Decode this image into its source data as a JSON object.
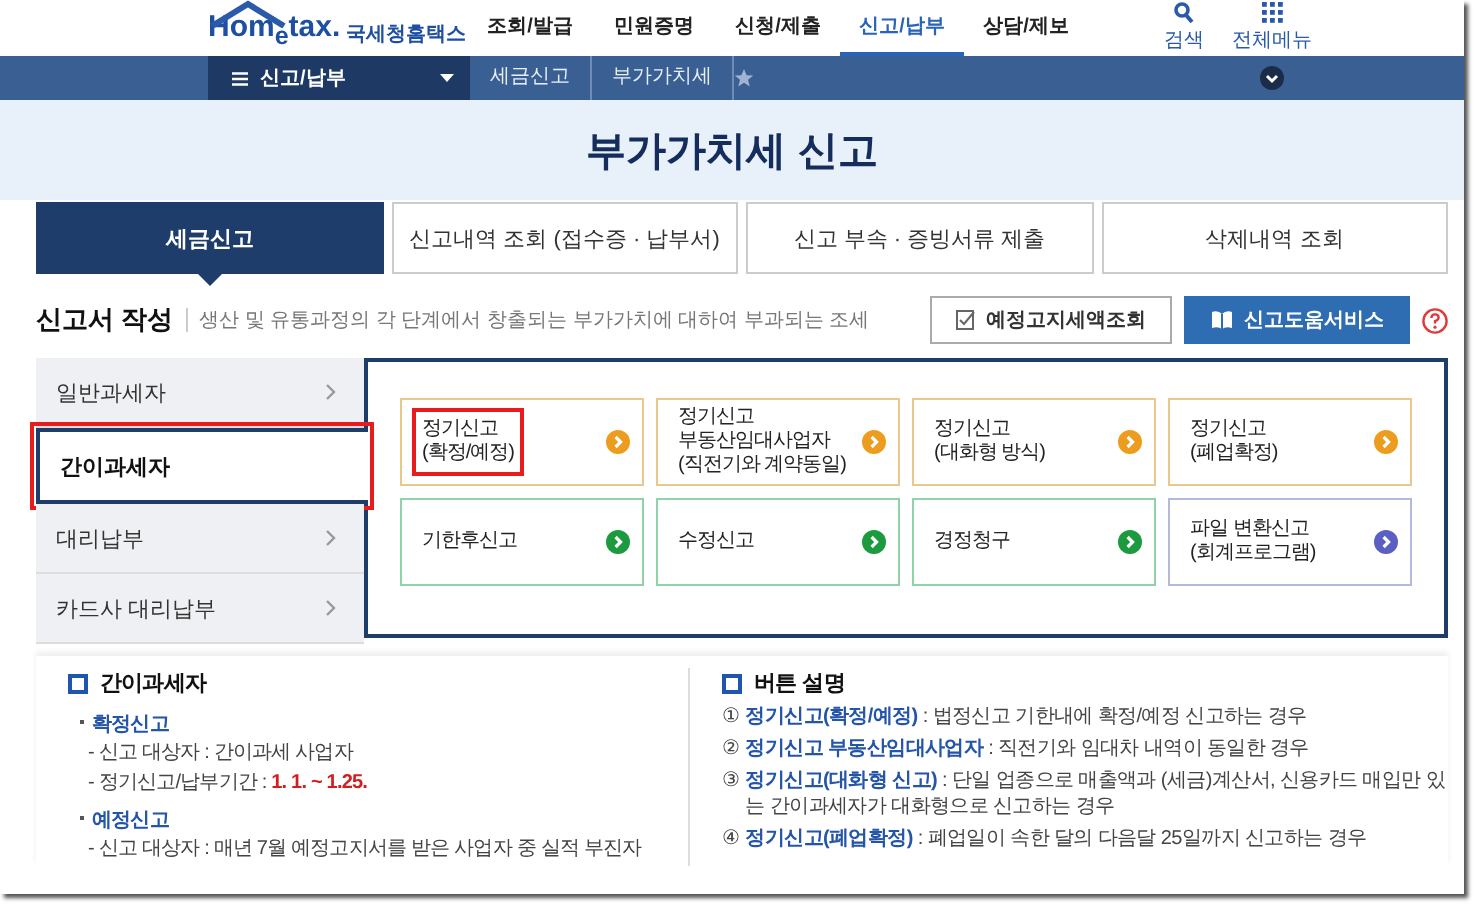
{
  "header": {
    "logo": "Hom$_{e}$tax.",
    "logo_caption": "국세청홈택스",
    "nav": [
      {
        "label": "조회/발급",
        "selected": false
      },
      {
        "label": "민원증명",
        "selected": false
      },
      {
        "label": "신청/제출",
        "selected": false
      },
      {
        "label": "신고/납부",
        "selected": true
      },
      {
        "label": "상담/제보",
        "selected": false
      }
    ],
    "search": "검색",
    "all_menu": "전체메뉴"
  },
  "breadcrumb": {
    "menu": "신고/납부",
    "items": [
      "세금신고",
      "부가가치세"
    ]
  },
  "page_title": "부가가치세 신고",
  "tabs": [
    {
      "label": "세금신고",
      "selected": true
    },
    {
      "label": "신고내역 조회 (접수증 · 납부서)",
      "selected": false
    },
    {
      "label": "신고 부속 · 증빙서류 제출",
      "selected": false
    },
    {
      "label": "삭제내역 조회",
      "selected": false
    }
  ],
  "section": {
    "title": "신고서 작성",
    "description": "생산 및 유통과정의 각 단계에서 창출되는 부가가치에 대하여 부과되는 조세",
    "buttons": [
      {
        "label": "예정고지세액조회",
        "kind": "outline"
      },
      {
        "label": "신고도움서비스",
        "kind": "primary"
      }
    ]
  },
  "sidebar": [
    {
      "label": "일반과세자",
      "selected": false,
      "highlighted": false
    },
    {
      "label": "간이과세자",
      "selected": true,
      "highlighted": true
    },
    {
      "label": "대리납부",
      "selected": false,
      "highlighted": false
    },
    {
      "label": "카드사 대리납부",
      "selected": false,
      "highlighted": false
    }
  ],
  "cards": [
    {
      "label": "정기신고\n(확정/예정)",
      "kind": "regular",
      "highlighted": true
    },
    {
      "label": "정기신고\n부동산임대사업자\n(직전기와 계약동일)",
      "kind": "regular",
      "highlighted": false
    },
    {
      "label": "정기신고\n(대화형 방식)",
      "kind": "regular",
      "highlighted": false
    },
    {
      "label": "정기신고\n(폐업확정)",
      "kind": "regular",
      "highlighted": false
    },
    {
      "label": "기한후신고",
      "kind": "amend",
      "highlighted": false
    },
    {
      "label": "수정신고",
      "kind": "amend",
      "highlighted": false
    },
    {
      "label": "경정청구",
      "kind": "amend",
      "highlighted": false
    },
    {
      "label": "파일 변환신고\n(회계프로그램)",
      "kind": "file",
      "highlighted": false
    }
  ],
  "info_left": {
    "title": "간이과세자",
    "groups": [
      {
        "heading": "확정신고",
        "lines": [
          {
            "text": "- 신고 대상자 : 간이과세 사업자"
          },
          {
            "text": "- 정기신고/납부기간 : ",
            "highlight": "1. 1. ~ 1.25."
          }
        ]
      },
      {
        "heading": "예정신고",
        "lines": [
          {
            "text": "- 신고 대상자 : 매년 7월 예정고지서를 받은 사업자 중 실적 부진자"
          }
        ]
      }
    ]
  },
  "info_right": {
    "title": "버튼 설명",
    "items": [
      {
        "number": "①",
        "term": "정기신고(확정/예정)",
        "text": " : 법정신고 기한내에 확정/예정 신고하는 경우"
      },
      {
        "number": "②",
        "term": "정기신고 부동산임대사업자",
        "text": " : 직전기와 임대차 내역이 동일한 경우"
      },
      {
        "number": "③",
        "term": "정기신고(대화형 신고)",
        "text": " : 단일 업종으로 매출액과 (세금)계산서, 신용카드 매입만 있는 간이과세자가 대화형으로 신고하는 경우"
      },
      {
        "number": "④",
        "term": "정기신고(폐업확정)",
        "text": " : 폐업일이 속한 달의 다음달 25일까지 신고하는 경우"
      }
    ]
  }
}
